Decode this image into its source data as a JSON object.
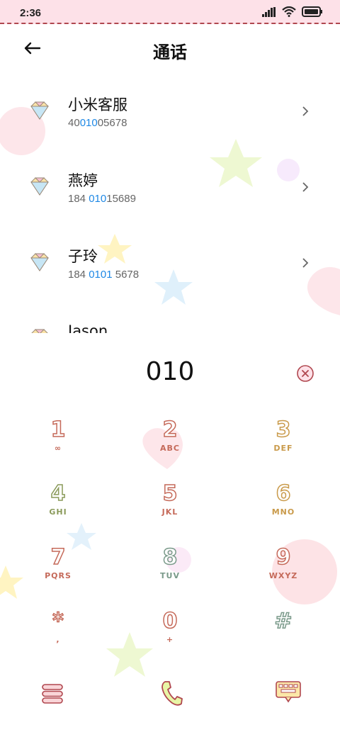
{
  "status": {
    "time": "2:36"
  },
  "header": {
    "title": "通话"
  },
  "contacts": [
    {
      "name": "小米客服",
      "num_pre": "40",
      "num_hl": "010",
      "num_post": "05678"
    },
    {
      "name": "燕婷",
      "num_pre": "184 ",
      "num_hl": "010",
      "num_post": "15689"
    },
    {
      "name": "子玲",
      "num_pre": "184 ",
      "num_hl": "0101",
      "num_post": " 5678"
    },
    {
      "name": "Jason",
      "num_pre": "",
      "num_hl": "",
      "num_post": ""
    }
  ],
  "dialer": {
    "input": "010"
  },
  "keypad": [
    {
      "digit": "1",
      "letters": "∞",
      "lcolor": "#c56a5a"
    },
    {
      "digit": "2",
      "letters": "ABC",
      "lcolor": "#c56a5a"
    },
    {
      "digit": "3",
      "letters": "DEF",
      "lcolor": "#c99a4a"
    },
    {
      "digit": "4",
      "letters": "GHI",
      "lcolor": "#8a9a5a"
    },
    {
      "digit": "5",
      "letters": "JKL",
      "lcolor": "#c56a5a"
    },
    {
      "digit": "6",
      "letters": "MNO",
      "lcolor": "#c99a4a"
    },
    {
      "digit": "7",
      "letters": "PQRS",
      "lcolor": "#c56a5a"
    },
    {
      "digit": "8",
      "letters": "TUV",
      "lcolor": "#7a9a8a"
    },
    {
      "digit": "9",
      "letters": "WXYZ",
      "lcolor": "#c56a5a"
    },
    {
      "digit": "*",
      "letters": ",",
      "lcolor": "#c56a5a"
    },
    {
      "digit": "0",
      "letters": "+",
      "lcolor": "#c56a5a"
    },
    {
      "digit": "#",
      "letters": "",
      "lcolor": "#7a9a8a"
    }
  ],
  "icons": {
    "back": "back-arrow-icon",
    "contact": "diamond-icon",
    "chevron": "chevron-right-icon",
    "delete": "delete-icon",
    "menu": "menu-icon",
    "call": "phone-call-icon",
    "keyboard": "keyboard-icon"
  }
}
